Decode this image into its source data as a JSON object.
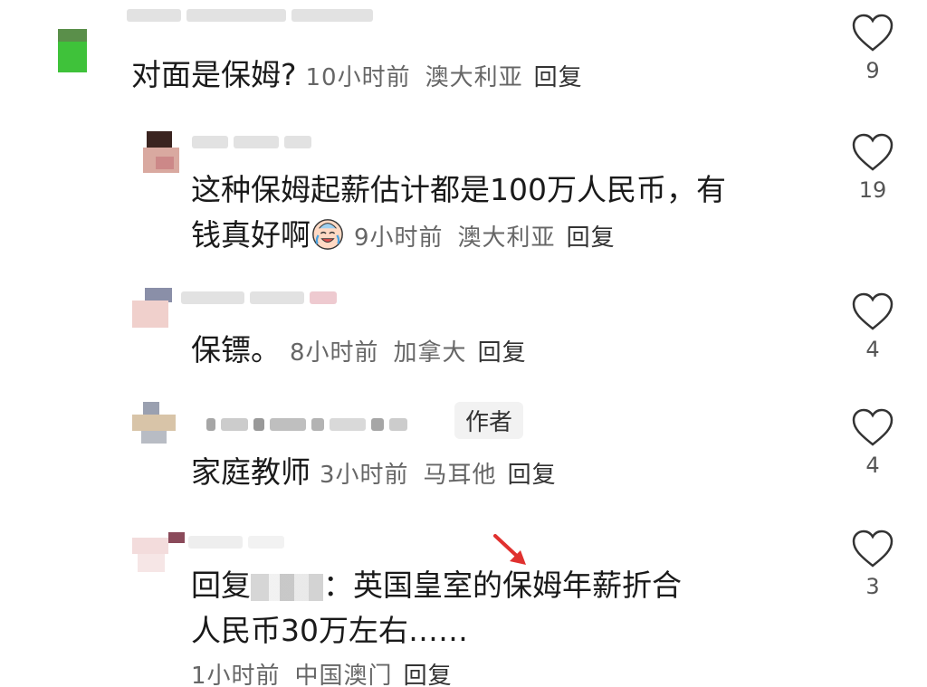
{
  "comments": [
    {
      "text": "对面是保姆?",
      "time": "10小时前",
      "location": "澳大利亚",
      "reply": "回复",
      "likes": "9"
    },
    {
      "text_line1": "这种保姆起薪估计都是100万人民币，有",
      "text_line2": "钱真好啊",
      "time": "9小时前",
      "location": "澳大利亚",
      "reply": "回复",
      "likes": "19"
    },
    {
      "text": "保镖。",
      "time": "8小时前",
      "location": "加拿大",
      "reply": "回复",
      "likes": "4"
    },
    {
      "author_badge": "作者",
      "text": "家庭教师",
      "time": "3小时前",
      "location": "马耳他",
      "reply": "回复",
      "likes": "4"
    },
    {
      "reply_prefix": "回复",
      "text_line1": "：英国皇室的保姆年薪折合",
      "text_line2": "人民币30万左右……",
      "time": "1小时前",
      "location": "中国澳门",
      "reply": "回复",
      "likes": "3"
    }
  ],
  "icons": {
    "like": "heart-outline-icon",
    "emoji": "crying-laughing-emoji-icon",
    "arrow": "red-arrow-icon"
  },
  "colors": {
    "arrow": "#e0312f",
    "text": "#1a1a1a",
    "meta": "#666666"
  }
}
